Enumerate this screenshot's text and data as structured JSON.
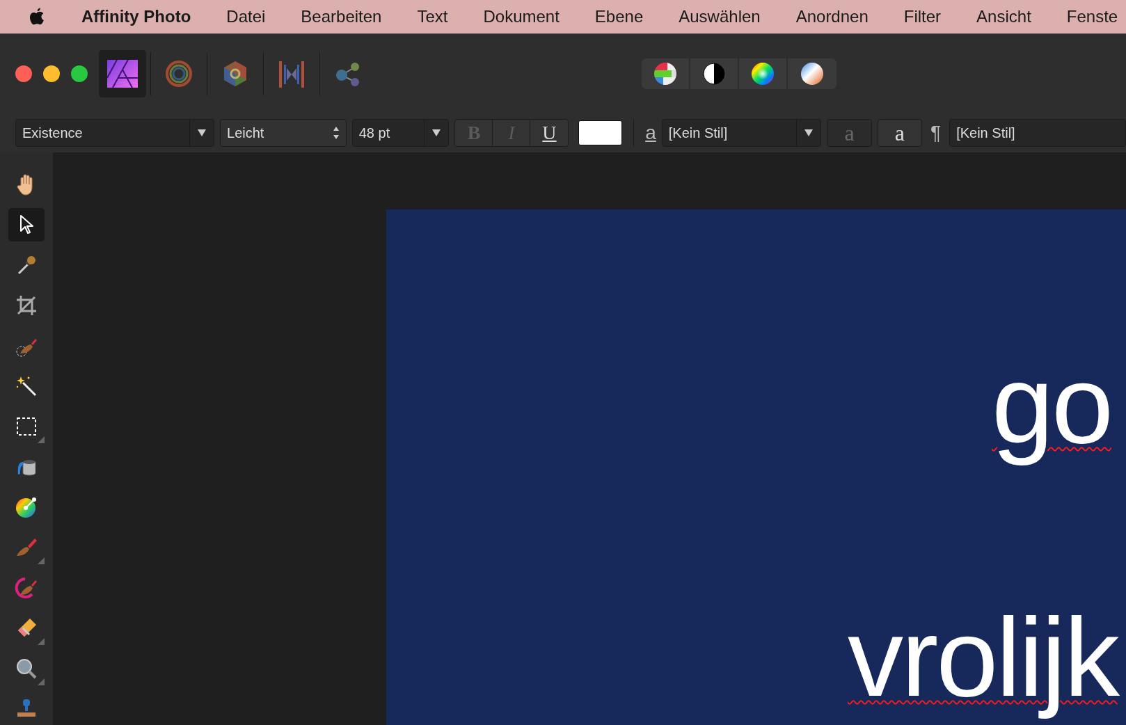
{
  "menu_bar": [
    {
      "kind": "app",
      "label": "Affinity Photo"
    },
    {
      "kind": "menu",
      "label": "Datei"
    },
    {
      "kind": "menu",
      "label": "Bearbeiten"
    },
    {
      "kind": "menu",
      "label": "Text"
    },
    {
      "kind": "menu",
      "label": "Dokument"
    },
    {
      "kind": "menu",
      "label": "Ebene"
    },
    {
      "kind": "menu",
      "label": "Auswählen"
    },
    {
      "kind": "menu",
      "label": "Anordnen"
    },
    {
      "kind": "menu",
      "label": "Filter"
    },
    {
      "kind": "menu",
      "label": "Ansicht"
    },
    {
      "kind": "menu",
      "label": "Fenste"
    }
  ],
  "personas": [
    {
      "kind": "photo",
      "selected": true
    },
    {
      "kind": "liquify",
      "selected": false
    },
    {
      "kind": "develop",
      "selected": false
    },
    {
      "kind": "tonemap",
      "selected": false
    },
    {
      "kind": "export",
      "selected": false
    }
  ],
  "studio_buttons": [
    {
      "kind": "channels"
    },
    {
      "kind": "contrast"
    },
    {
      "kind": "hue"
    },
    {
      "kind": "gradient"
    }
  ],
  "context_bar": {
    "font_family": "Existence",
    "font_style": "Leicht",
    "font_size": "48 pt",
    "style_buttons": [
      {
        "label": "B",
        "kind": "bold",
        "enabled": false
      },
      {
        "label": "I",
        "kind": "italic",
        "enabled": false
      },
      {
        "label": "U",
        "kind": "underline",
        "enabled": true
      }
    ],
    "char_style_icon": "a",
    "char_style": "[Kein Stil]",
    "circled_button": "a",
    "plain_button": "a",
    "para_icon": "¶",
    "para_style": "[Kein Stil]"
  },
  "tools": [
    {
      "kind": "hand",
      "selected": false,
      "flyout": false
    },
    {
      "kind": "pointer",
      "selected": true,
      "flyout": false
    },
    {
      "kind": "picker",
      "selected": false,
      "flyout": false
    },
    {
      "kind": "crop",
      "selected": false,
      "flyout": false
    },
    {
      "kind": "selbrush",
      "selected": false,
      "flyout": false
    },
    {
      "kind": "wand",
      "selected": false,
      "flyout": false
    },
    {
      "kind": "marquee",
      "selected": false,
      "flyout": true
    },
    {
      "kind": "fill",
      "selected": false,
      "flyout": false
    },
    {
      "kind": "colorwheel",
      "selected": false,
      "flyout": false
    },
    {
      "kind": "brush",
      "selected": false,
      "flyout": true
    },
    {
      "kind": "mixer",
      "selected": false,
      "flyout": false
    },
    {
      "kind": "eraser",
      "selected": false,
      "flyout": true
    },
    {
      "kind": "zoom",
      "selected": false,
      "flyout": true
    },
    {
      "kind": "stamp",
      "selected": false,
      "flyout": false
    }
  ],
  "document": {
    "texts": [
      {
        "text": "go",
        "misspelled": true
      },
      {
        "text": "vrolijk",
        "misspelled": true
      }
    ]
  }
}
